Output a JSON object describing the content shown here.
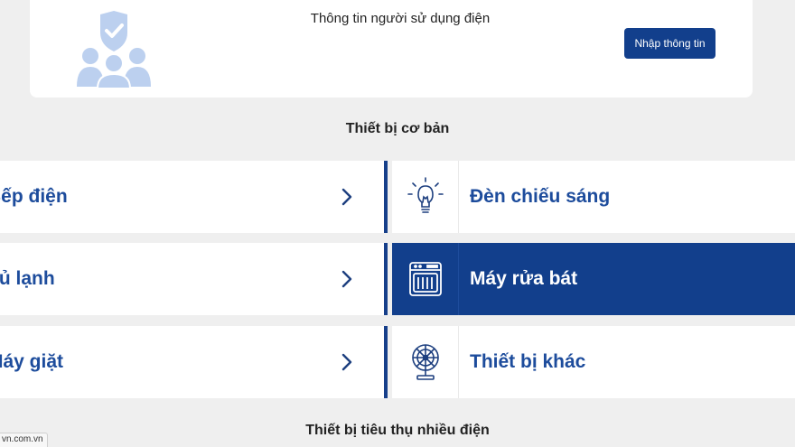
{
  "user_card": {
    "title": "Thông tin người sử dụng điện",
    "button_label": "Nhập thông tin"
  },
  "basic_section": {
    "title": "Thiết bị cơ bản",
    "left_items": [
      {
        "label": "Bếp điện"
      },
      {
        "label": "Tủ lạnh"
      },
      {
        "label": "Máy giặt"
      }
    ],
    "right_items": [
      {
        "label": "Đèn chiếu sáng",
        "icon": "lightbulb-icon",
        "active": false
      },
      {
        "label": "Máy rửa bát",
        "icon": "dishwasher-icon",
        "active": true
      },
      {
        "label": "Thiết bị khác",
        "icon": "fan-icon",
        "active": false
      }
    ]
  },
  "heavy_section": {
    "title": "Thiết bị tiêu thụ nhiều điện"
  },
  "status_bar": {
    "url": "vn.com.vn"
  },
  "colors": {
    "primary": "#123f8c",
    "label_blue": "#1d4c9c",
    "background": "#efefef",
    "illustration": "#bcd0ef"
  }
}
